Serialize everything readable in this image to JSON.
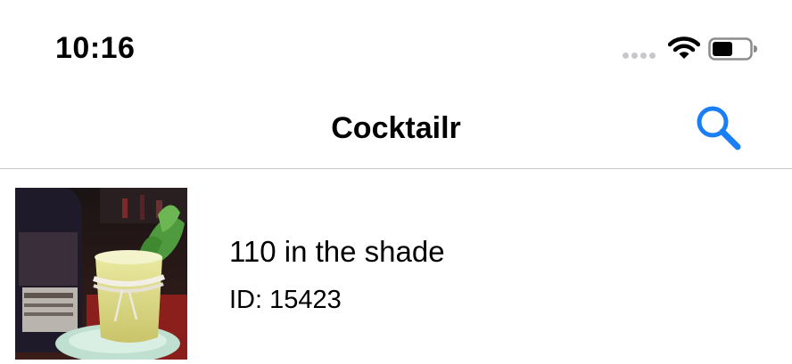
{
  "status_bar": {
    "time": "10:16"
  },
  "nav_bar": {
    "title": "Cocktailr",
    "search_icon": "search-icon",
    "accent_color": "#1a7ef7"
  },
  "drinks": [
    {
      "name": "110 in the shade",
      "id_label": "ID: 15423",
      "thumbnail": "cocktail-photo"
    }
  ]
}
